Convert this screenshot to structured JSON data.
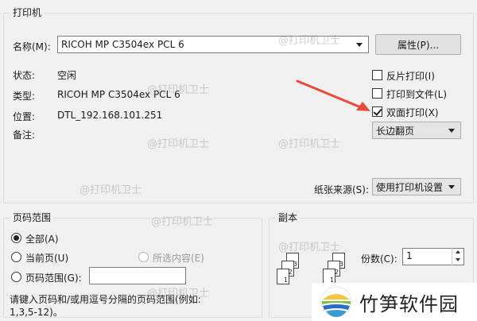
{
  "printer_group": {
    "title": "打印机",
    "name_label": "名称(M):",
    "name_value": "RICOH MP C3504ex PCL 6",
    "properties_button": "属性(P)...",
    "status_label": "状态:",
    "status_value": "空闲",
    "type_label": "类型:",
    "type_value": "RICOH MP C3504ex PCL 6",
    "location_label": "位置:",
    "location_value": "DTL_192.168.101.251",
    "comment_label": "备注:",
    "reverse_print": "反片打印(I)",
    "print_to_file": "打印到文件(L)",
    "duplex_print": "双面打印(X)",
    "duplex_mode": "长边翻页",
    "paper_source_label": "纸张来源(S):",
    "paper_source_value": "使用打印机设置",
    "checks": {
      "reverse": false,
      "to_file": false,
      "duplex": true
    }
  },
  "page_range_group": {
    "title": "页码范围",
    "all_pages": "全部(A)",
    "current_page": "当前页(U)",
    "selection": "所选内容(E)",
    "pages": "页码范围(G):",
    "pages_value": "",
    "hint": "请键入页码和/或用逗号分隔的页码范围(例如:",
    "hint_example": "1,3,5-12)。",
    "selected": "all"
  },
  "copies_group": {
    "title": "副本",
    "copies_label": "份数(C):",
    "copies_value": "1",
    "stack_a_pages": [
      "3",
      "2",
      "1"
    ],
    "stack_b_pages": [
      "3",
      "2",
      "1"
    ]
  },
  "watermark": "@打印机卫士",
  "brand": {
    "name": "竹笋软件园"
  },
  "colors": {
    "arrow": "#e84b3c",
    "accent": "#2b6cc4"
  }
}
